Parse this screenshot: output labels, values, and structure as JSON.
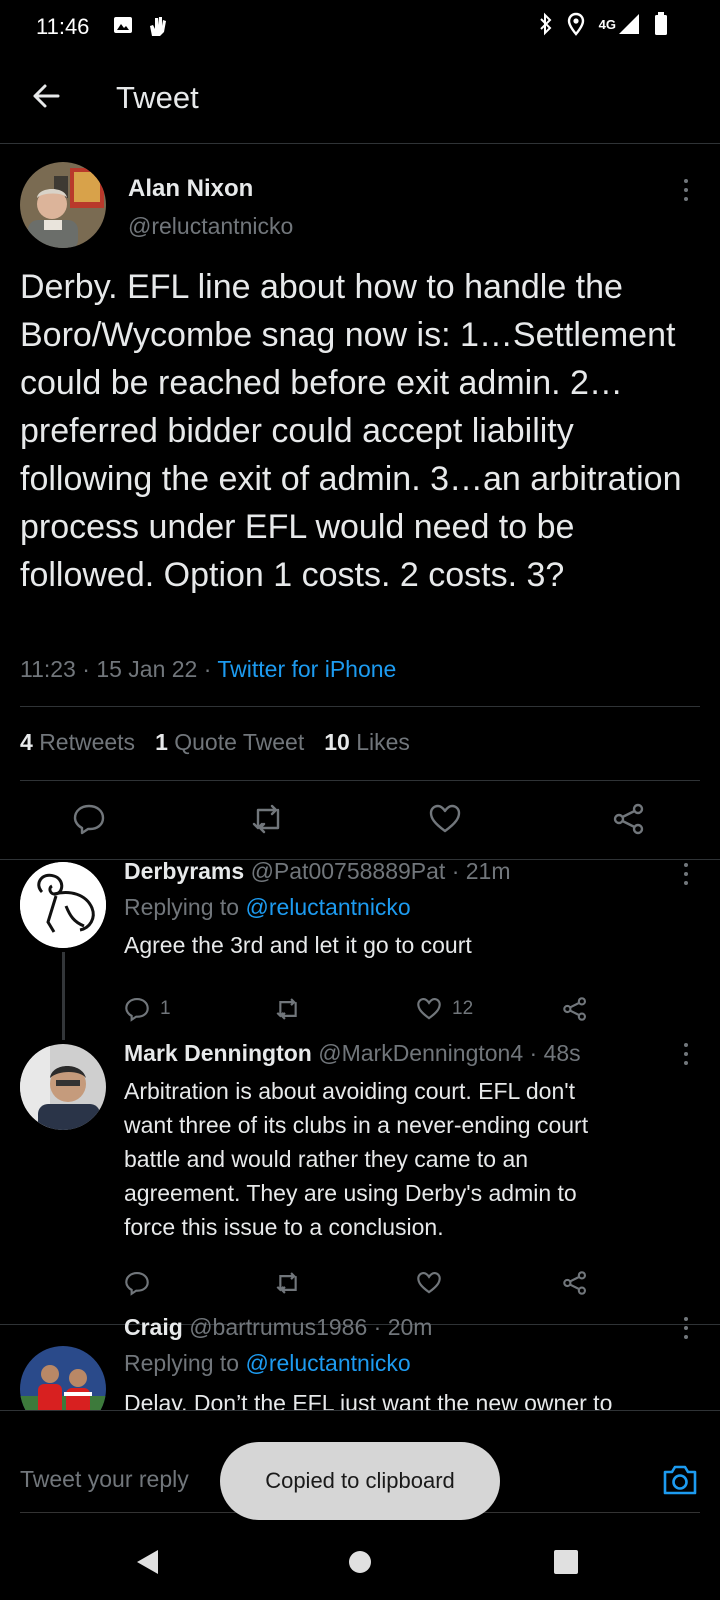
{
  "status_bar": {
    "time": "11:46",
    "network": "4G"
  },
  "header": {
    "title": "Tweet"
  },
  "tweet": {
    "author_name": "Alan Nixon",
    "author_handle": "@reluctantnicko",
    "text": "Derby. EFL line about how to handle the Boro/Wycombe snag now is: 1…Settlement could be reached before exit admin. 2…preferred bidder could accept liability following the exit of admin. 3…an arbitration process under EFL would need to be followed. Option 1 costs. 2 costs. 3?",
    "time": "11:23",
    "date": "15 Jan 22",
    "source": "Twitter for iPhone",
    "retweets_count": "4",
    "retweets_label": "Retweets",
    "quotes_count": "1",
    "quotes_label": "Quote Tweet",
    "likes_count": "10",
    "likes_label": "Likes"
  },
  "replies": [
    {
      "name": "Derbyrams",
      "handle": "@Pat00758889Pat",
      "age": "21m",
      "replying_prefix": "Replying to ",
      "replying_to": "@reluctantnicko",
      "text": "Agree the 3rd and let it go to court",
      "reply_count": "1",
      "retweet_count": "",
      "like_count": "12"
    },
    {
      "name": "Mark Dennington",
      "handle": "@MarkDennington4",
      "age": "48s",
      "text_lines": [
        "Arbitration is about avoiding court. EFL don't",
        "want three of its clubs in a never-ending court",
        "battle and would rather they came to an",
        "agreement. They are using Derby's admin to",
        "force this issue to a conclusion."
      ]
    },
    {
      "name": "Craig",
      "handle": "@bartrumus1986",
      "age": "20m",
      "replying_prefix": "Replying to ",
      "replying_to": "@reluctantnicko",
      "text_partial": "Delay. Don’t the EFL just want the new owner to"
    }
  ],
  "reply_composer": {
    "placeholder": "Tweet your reply"
  },
  "toast": {
    "text": "Copied to clipboard"
  },
  "colors": {
    "accent": "#1d9bf0",
    "muted": "#71767b",
    "background": "#000000"
  }
}
